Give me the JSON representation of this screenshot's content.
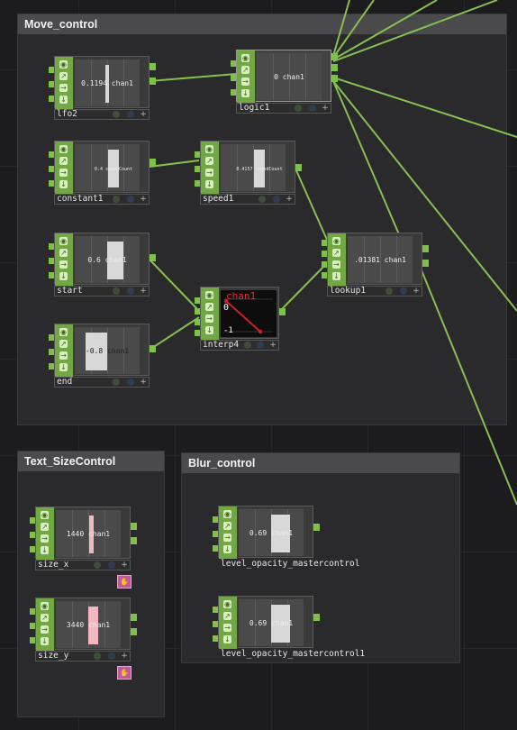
{
  "groups": {
    "move": {
      "title": "Move_control"
    },
    "text": {
      "title": "Text_SizeControl"
    },
    "blur": {
      "title": "Blur_control"
    }
  },
  "nodes": {
    "lfo2": {
      "name": "lfo2",
      "value": "0.1194 chan1"
    },
    "logic1": {
      "name": "logic1",
      "value": "0 chan1"
    },
    "constant1": {
      "name": "constant1",
      "value": "0.4 speedCount"
    },
    "speed1": {
      "name": "speed1",
      "value": "0.4157 speedCount"
    },
    "start": {
      "name": "start",
      "value": "0.6 chan1"
    },
    "end": {
      "name": "end",
      "value": "-0.8 chan1"
    },
    "lookup1": {
      "name": "lookup1",
      "value": ".01381 chan1"
    },
    "interp4": {
      "name": "interp4",
      "graph_title": "chan1",
      "graph_top": "0",
      "graph_bottom": "-1"
    },
    "size_x": {
      "name": "size_x",
      "value": "1440 chan1"
    },
    "size_y": {
      "name": "size_y",
      "value": "3440 chan1"
    },
    "level1": {
      "name": "level_opacity_mastercontrol",
      "value": "0.69 chan1"
    },
    "level2": {
      "name": "level_opacity_mastercontrol1",
      "value": "0.69 chan1"
    }
  },
  "icons": {
    "viewer_flag": "circle-flag",
    "display_flag": "blue-circle-flag",
    "expand": "plus-icon",
    "python_badge": "hand-icon"
  },
  "colors": {
    "background": "#1c1c1e",
    "group_panel": "#2a2a2c",
    "group_header": "#4a4a4c",
    "chop_green": "#72a843",
    "wire": "#86c04e",
    "badge": "#c05a9c"
  }
}
